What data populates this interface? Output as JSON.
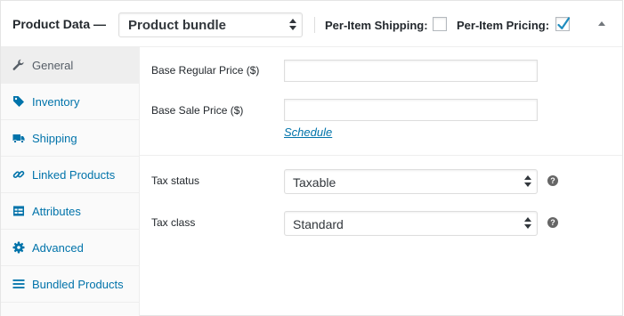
{
  "header": {
    "title": "Product Data —",
    "product_type": "Product bundle",
    "per_item_shipping_label": "Per-Item Shipping:",
    "per_item_shipping_checked": false,
    "per_item_pricing_label": "Per-Item Pricing:",
    "per_item_pricing_checked": true
  },
  "sidebar": {
    "items": [
      {
        "label": "General",
        "icon": "wrench-icon",
        "active": true
      },
      {
        "label": "Inventory",
        "icon": "tag-icon",
        "active": false
      },
      {
        "label": "Shipping",
        "icon": "truck-icon",
        "active": false
      },
      {
        "label": "Linked Products",
        "icon": "link-icon",
        "active": false
      },
      {
        "label": "Attributes",
        "icon": "table-icon",
        "active": false
      },
      {
        "label": "Advanced",
        "icon": "gear-icon",
        "active": false
      },
      {
        "label": "Bundled Products",
        "icon": "list-icon",
        "active": false
      }
    ]
  },
  "general": {
    "regular_price_label": "Base Regular Price ($)",
    "regular_price_value": "",
    "sale_price_label": "Base Sale Price ($)",
    "sale_price_value": "",
    "schedule_link": "Schedule",
    "tax_status_label": "Tax status",
    "tax_status_value": "Taxable",
    "tax_class_label": "Tax class",
    "tax_class_value": "Standard",
    "help_glyph": "?"
  },
  "colors": {
    "link": "#0073aa",
    "active_tab_bg": "#eeeeee",
    "sidebar_bg": "#fafafa",
    "checkmark": "#1e8cbe",
    "help_icon_bg": "#666666"
  }
}
